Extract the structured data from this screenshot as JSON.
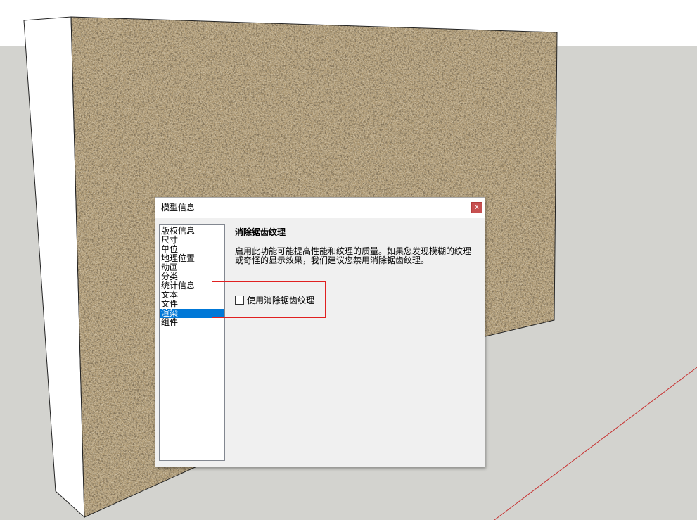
{
  "dialog": {
    "title": "模型信息",
    "close_label": "x"
  },
  "nav": {
    "items": [
      {
        "label": "版权信息",
        "selected": false
      },
      {
        "label": "尺寸",
        "selected": false
      },
      {
        "label": "单位",
        "selected": false
      },
      {
        "label": "地理位置",
        "selected": false
      },
      {
        "label": "动画",
        "selected": false
      },
      {
        "label": "分类",
        "selected": false
      },
      {
        "label": "统计信息",
        "selected": false
      },
      {
        "label": "文本",
        "selected": false
      },
      {
        "label": "文件",
        "selected": false
      },
      {
        "label": "渲染",
        "selected": true
      },
      {
        "label": "组件",
        "selected": false
      }
    ]
  },
  "panel": {
    "title": "消除锯齿纹理",
    "description_line1": "启用此功能可能提高性能和纹理的质量。如果您发现模糊的纹理",
    "description_line2": "或奇怪的显示效果，我们建议您禁用消除锯齿纹理。",
    "checkbox_label": "使用消除锯齿纹理",
    "checkbox_checked": false
  },
  "colors": {
    "sky": "#ffffff",
    "ground": "#d3d3cf",
    "wall_side": "#ffffff",
    "gravel_base": "#a58e66",
    "selection": "#0078d7",
    "highlight": "#e02020",
    "red_axis": "#c83030"
  }
}
